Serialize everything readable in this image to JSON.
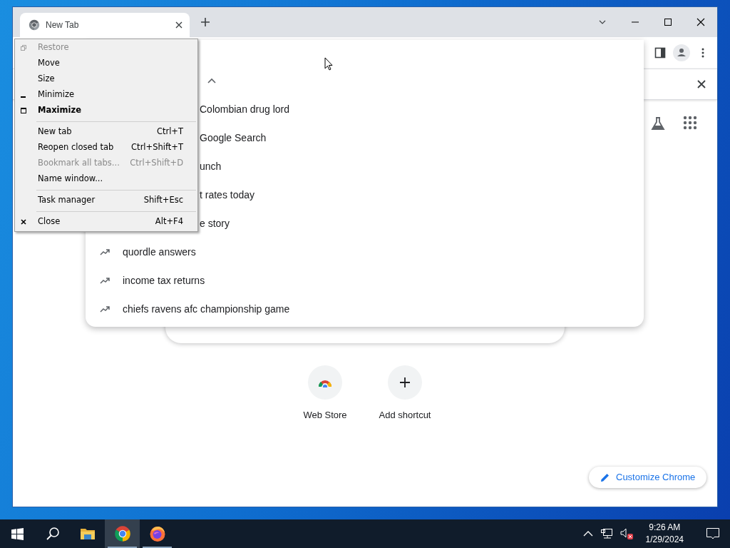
{
  "window": {
    "tab": {
      "title": "New Tab",
      "selected": true
    }
  },
  "system_menu": {
    "items": [
      {
        "kind": "restore",
        "label": "Restore",
        "disabled": true,
        "default": false
      },
      {
        "kind": "item",
        "label": "Move",
        "disabled": false,
        "default": false
      },
      {
        "kind": "item",
        "label": "Size",
        "disabled": false,
        "default": false
      },
      {
        "kind": "minimize",
        "label": "Minimize",
        "disabled": false,
        "default": false
      },
      {
        "kind": "maximize",
        "label": "Maximize",
        "disabled": false,
        "default": true
      },
      {
        "kind": "separator"
      },
      {
        "kind": "item",
        "label": "New tab",
        "shortcut": "Ctrl+T",
        "disabled": false,
        "default": false
      },
      {
        "kind": "item",
        "label": "Reopen closed tab",
        "shortcut": "Ctrl+Shift+T",
        "disabled": false,
        "default": false
      },
      {
        "kind": "item",
        "label": "Bookmark all tabs...",
        "shortcut": "Ctrl+Shift+D",
        "disabled": true,
        "default": false
      },
      {
        "kind": "item",
        "label": "Name window...",
        "disabled": false,
        "default": false
      },
      {
        "kind": "separator"
      },
      {
        "kind": "item",
        "label": "Task manager",
        "shortcut": "Shift+Esc",
        "disabled": false,
        "default": false
      },
      {
        "kind": "separator"
      },
      {
        "kind": "close",
        "label": "Close",
        "shortcut": "Alt+F4",
        "disabled": false,
        "default": false
      }
    ]
  },
  "suggestions": {
    "expanded": true,
    "items": [
      {
        "kind": "covered",
        "text": "Colombian drug lord"
      },
      {
        "kind": "covered",
        "text": "Google Search"
      },
      {
        "kind": "covered",
        "text": "unch"
      },
      {
        "kind": "covered",
        "text": "t rates today"
      },
      {
        "kind": "covered",
        "text": "e story"
      },
      {
        "kind": "trending",
        "text": "quordle answers"
      },
      {
        "kind": "trending",
        "text": "income tax returns"
      },
      {
        "kind": "trending",
        "text": "chiefs ravens afc championship game"
      }
    ]
  },
  "shortcuts": [
    {
      "kind": "webstore",
      "label": "Web Store"
    },
    {
      "kind": "add",
      "label": "Add shortcut"
    }
  ],
  "customize_button": {
    "label": "Customize Chrome"
  },
  "taskbar": {
    "apps": [
      {
        "kind": "explorer",
        "selected": false,
        "running": false
      },
      {
        "kind": "chrome",
        "selected": true,
        "running": true
      },
      {
        "kind": "firefox",
        "selected": false,
        "running": true
      }
    ],
    "volume_muted": true,
    "clock": {
      "time": "9:26 AM",
      "date": "1/29/2024"
    }
  }
}
